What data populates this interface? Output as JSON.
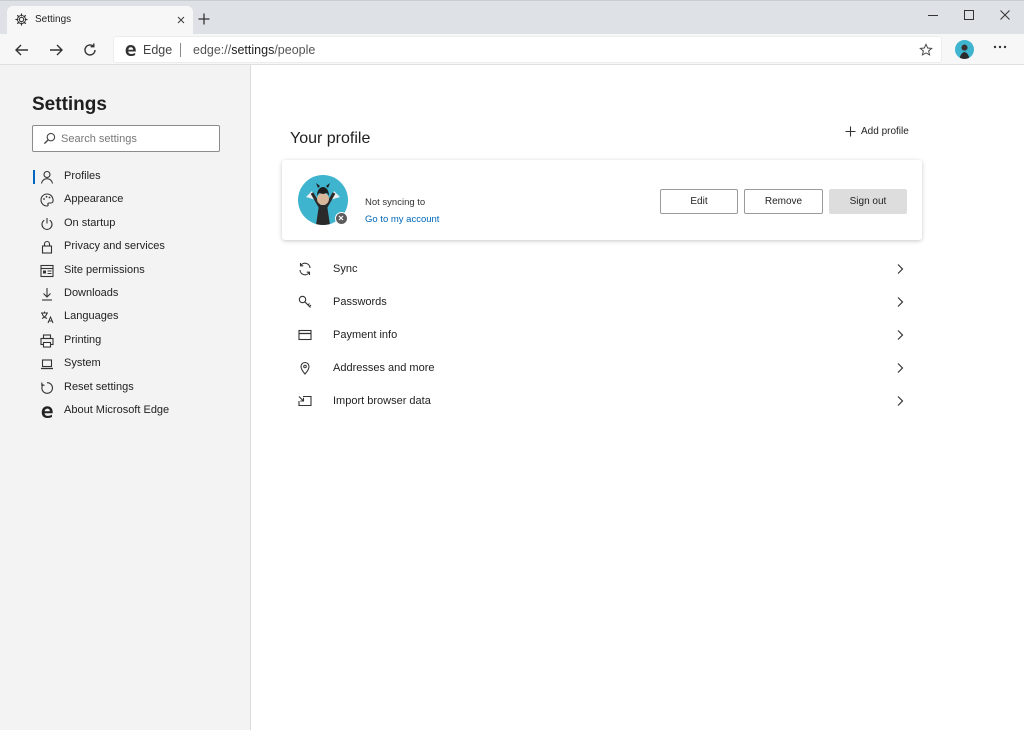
{
  "browser": {
    "tab_title": "Settings",
    "address_site": "Edge",
    "address_url_prefix": "edge://",
    "address_url_host": "settings",
    "address_url_path": "/people"
  },
  "sidebar": {
    "title": "Settings",
    "search_placeholder": "Search settings",
    "items": [
      {
        "label": "Profiles",
        "icon": "person-icon",
        "active": true
      },
      {
        "label": "Appearance",
        "icon": "palette-icon"
      },
      {
        "label": "On startup",
        "icon": "power-icon"
      },
      {
        "label": "Privacy and services",
        "icon": "lock-icon"
      },
      {
        "label": "Site permissions",
        "icon": "site-permissions-icon"
      },
      {
        "label": "Downloads",
        "icon": "download-icon"
      },
      {
        "label": "Languages",
        "icon": "languages-icon"
      },
      {
        "label": "Printing",
        "icon": "printer-icon"
      },
      {
        "label": "System",
        "icon": "laptop-icon"
      },
      {
        "label": "Reset settings",
        "icon": "reset-icon"
      },
      {
        "label": "About Microsoft Edge",
        "icon": "edge-icon"
      }
    ]
  },
  "main": {
    "profile_title": "Your profile",
    "add_profile_label": "Add profile",
    "profile_card": {
      "status_text": "Not syncing to",
      "account_link": "Go to my account",
      "edit_label": "Edit",
      "remove_label": "Remove",
      "sign_out_label": "Sign out"
    },
    "settings_rows": [
      {
        "label": "Sync",
        "icon": "sync-icon"
      },
      {
        "label": "Passwords",
        "icon": "key-icon"
      },
      {
        "label": "Payment info",
        "icon": "credit-card-icon"
      },
      {
        "label": "Addresses and more",
        "icon": "location-pin-icon"
      },
      {
        "label": "Import browser data",
        "icon": "import-icon"
      }
    ]
  },
  "colors": {
    "accent": "#0067c0",
    "link": "#0067b8",
    "avatar_bg": "#3fb4cf"
  }
}
